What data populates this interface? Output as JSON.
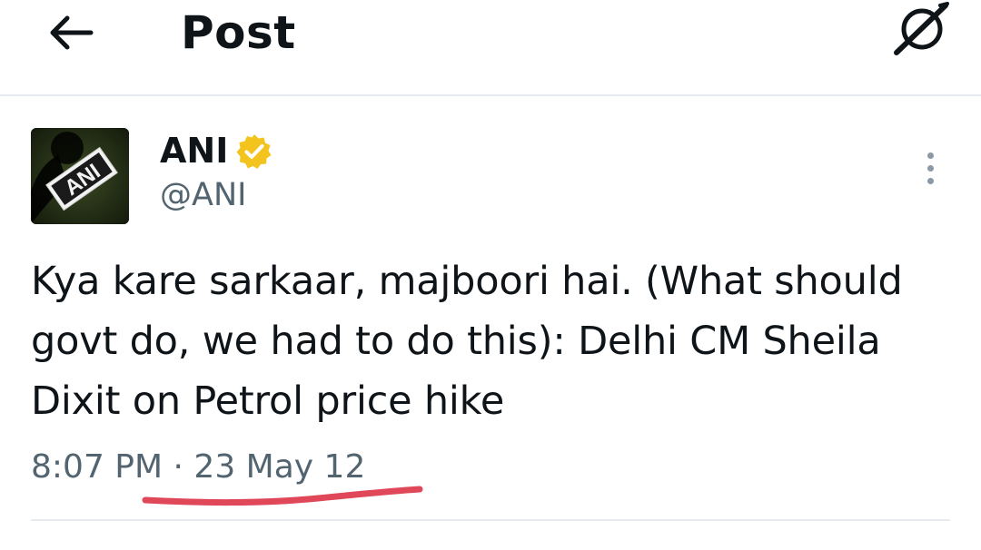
{
  "header": {
    "back_icon": "arrow-left-icon",
    "title": "Post",
    "grok_icon": "grok-icon"
  },
  "tweet": {
    "author": {
      "display_name": "ANI",
      "handle": "@ANI",
      "verified": true,
      "verified_color": "#f4c41e",
      "avatar_logo_text": "ANI"
    },
    "more_icon": "more-vertical-icon",
    "text": "Kya kare sarkaar, majboori hai. (What should govt do, we had to do this): Delhi CM Sheila Dixit on Petrol price hike",
    "time": "8:07 PM",
    "separator": "·",
    "date": "23 May 12"
  },
  "annotation": {
    "underline_color": "#e0485a"
  },
  "colors": {
    "text_primary": "#0f1419",
    "text_secondary": "#536471",
    "divider": "#e7ebef"
  }
}
